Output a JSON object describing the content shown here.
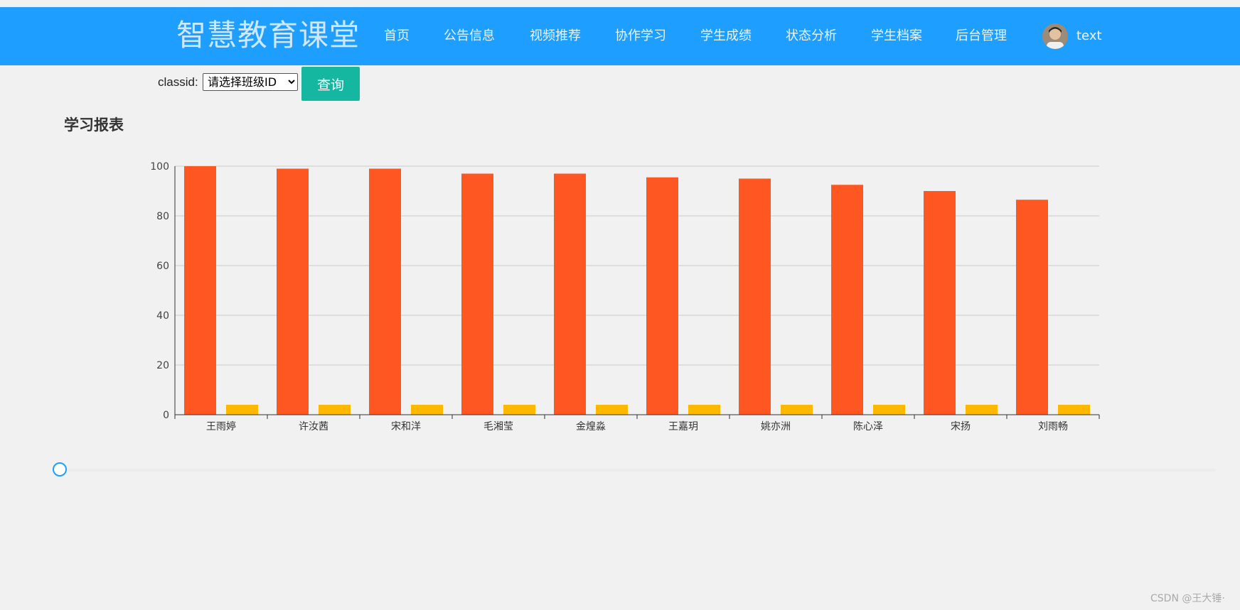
{
  "header": {
    "logo": "智慧教育课堂",
    "nav": [
      "首页",
      "公告信息",
      "视频推荐",
      "协作学习",
      "学生成绩",
      "状态分析",
      "学生档案",
      "后台管理"
    ],
    "user_name": "text",
    "bg_color": "#1e9fff"
  },
  "filter": {
    "label": "classid:",
    "select_value": "请选择班级ID",
    "query_label": "查询"
  },
  "report": {
    "title": "学习报表"
  },
  "chart_data": {
    "type": "bar",
    "title": "",
    "xlabel": "",
    "ylabel": "",
    "categories": [
      "王雨婷",
      "许汝茜",
      "宋和洋",
      "毛湘莹",
      "金煌淼",
      "王嘉玥",
      "姚亦洲",
      "陈心泽",
      "宋扬",
      "刘雨畅"
    ],
    "series": [
      {
        "color": "#ff5722",
        "values": [
          100,
          99,
          99,
          97,
          97,
          95.5,
          95,
          92.5,
          90,
          86.5
        ]
      },
      {
        "color": "#ffb800",
        "values": [
          4,
          4,
          4,
          4,
          4,
          4,
          4,
          4,
          4,
          4
        ]
      }
    ],
    "ylim": [
      0,
      100
    ],
    "yticks": [
      0,
      20,
      40,
      60,
      80,
      100
    ],
    "grid": true
  },
  "watermark": "CSDN @王大锤·"
}
